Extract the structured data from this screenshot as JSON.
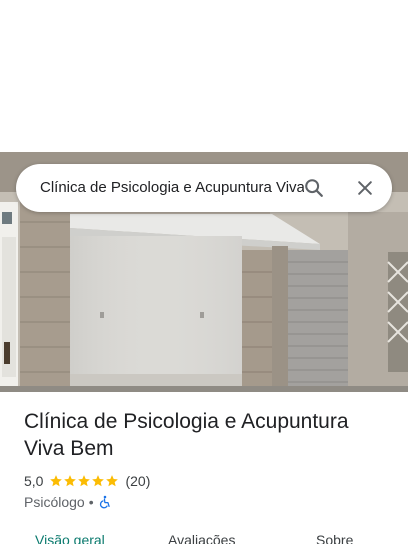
{
  "search": {
    "query": "Clínica de Psicologia e Acupuntura Viva Bem"
  },
  "place": {
    "name": "Clínica de Psicologia e Acupuntura Viva Bem",
    "rating_value": "5,0",
    "rating_fraction": 1.0,
    "review_count": "(20)",
    "category": "Psicólogo",
    "separator": "•",
    "accessibility_icon": "wheelchair-icon"
  },
  "tabs": [
    {
      "label": "Visão geral",
      "active": true
    },
    {
      "label": "Avaliações",
      "active": false
    },
    {
      "label": "Sobre",
      "active": false
    }
  ],
  "colors": {
    "star": "#fbbc04",
    "accent": "#0b7a6e",
    "accessibility": "#1a73e8"
  }
}
